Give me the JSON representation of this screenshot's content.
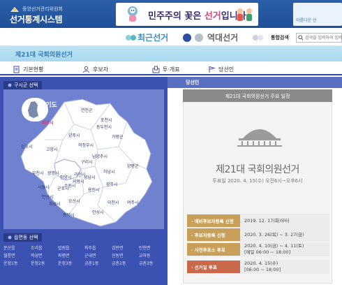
{
  "header": {
    "org_name": "중앙선거관리위원회",
    "system_name": "선거통계시스템",
    "banner_text_pre": "민주주의 꽃은 ",
    "banner_text_hl": "선거",
    "banner_text_post": "입니다",
    "promo_right_text": "아름다운 선"
  },
  "election_tabs": {
    "recent_label": "최근선거",
    "past_label": "역대선거"
  },
  "search": {
    "label": "통합검색",
    "placeholder": "검색을 입력하여 입력하세요"
  },
  "election_title": "제21대 국회의원선거",
  "menu": [
    {
      "label": "기본현황",
      "icon": "document-icon"
    },
    {
      "label": "후보자",
      "icon": "person-icon"
    },
    {
      "label": "투·개표",
      "icon": "ballot-icon"
    },
    {
      "label": "당선인",
      "icon": "flag-icon"
    }
  ],
  "left_panel": {
    "region_tab_label": "구시군 선택",
    "province_label": "경기도",
    "district_tab_label": "읍면동 선택",
    "cities": [
      "연천군",
      "포천시",
      "동두천시",
      "파주시",
      "양주시",
      "가평군",
      "고양시",
      "의정부시",
      "남양주시",
      "김포시",
      "구리시",
      "부천시",
      "광명시",
      "하남시",
      "양평군",
      "시흥시",
      "안양시",
      "군포시",
      "과천시",
      "의왕시",
      "성남시",
      "광주시",
      "안산시",
      "수원시",
      "용인시",
      "이천시",
      "여주시",
      "화성시",
      "오산시",
      "평택시",
      "안성시"
    ],
    "districts": [
      [
        "문산읍",
        "조리읍",
        "법원읍",
        "파주읍",
        "검판면",
        "탄현면"
      ],
      [
        "월롱면",
        "적성면",
        "파평면",
        "군내면",
        "진동면",
        "교하동"
      ],
      [
        "운정1동",
        "운정2동",
        "운정3동",
        "금촌1동",
        "금촌2동",
        "금촌3동"
      ]
    ]
  },
  "right_panel": {
    "header_label": "당선인",
    "card_title": "제21대 국회의원선거 주요 일정",
    "big_title": "제21대 국회의원선거",
    "big_sub": "투표일 2020. 4. 15(수) 오전6시~오후6시",
    "schedule": [
      {
        "label": "· 예비후보자등록 신청",
        "value": "2019. 12. 17(화)부터",
        "color": "#c9a05a"
      },
      {
        "label": "· 후보자등록 신청",
        "value": "2020. 3. 26(목) ~ 3. 27(금)",
        "color": "#c9a05a"
      },
      {
        "label": "· 사전투표소 투표",
        "value": "2020. 4. 10(금) ~ 4. 11(토)",
        "value2": "[매일 06:00 ~ 18:00]",
        "color": "#c9a05a"
      },
      {
        "label": "· 선거일 투표",
        "value": "2020. 4. 15(수)",
        "value2": "[06:00 ~ 18:00]",
        "color": "#c9684a"
      }
    ]
  },
  "colors": {
    "header_blue": "#1f4f98",
    "map_panel": "#3b52b3",
    "accent_cyan": "#3a8fc9"
  }
}
